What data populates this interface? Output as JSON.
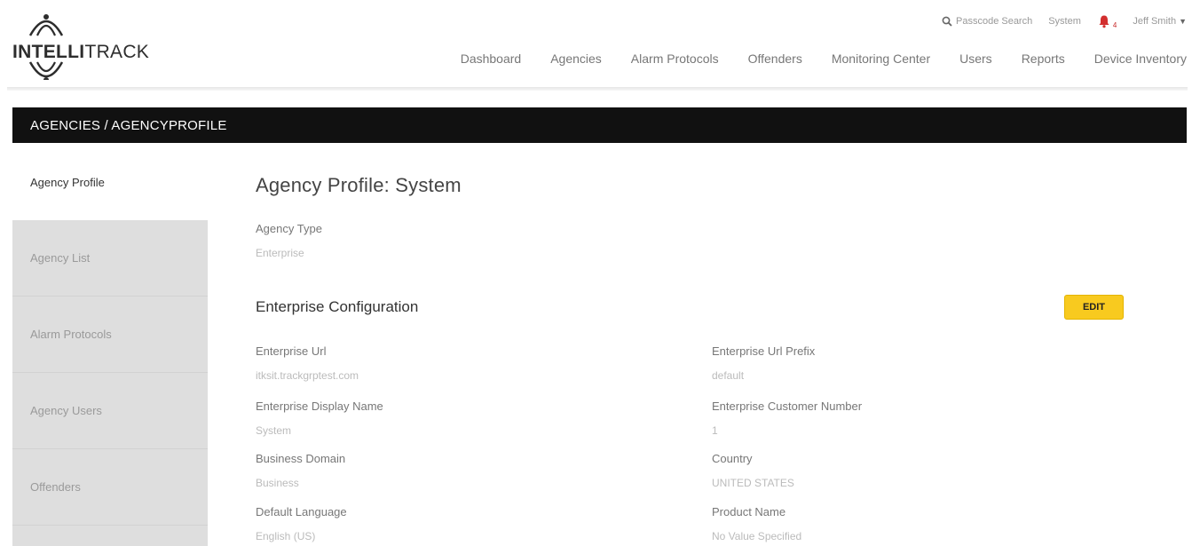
{
  "logo": {
    "bold": "INTELLI",
    "regular": "TRACK"
  },
  "utility": {
    "search_label": "Passcode Search",
    "agency": "System",
    "notification_count": "4",
    "user_name": "Jeff Smith"
  },
  "nav": {
    "items": [
      "Dashboard",
      "Agencies",
      "Alarm Protocols",
      "Offenders",
      "Monitoring Center",
      "Users",
      "Reports",
      "Device Inventory"
    ]
  },
  "breadcrumb": "AGENCIES / AGENCYPROFILE",
  "sidebar": {
    "items": [
      {
        "label": "Agency Profile",
        "active": true
      },
      {
        "label": "Agency List"
      },
      {
        "label": "Alarm Protocols"
      },
      {
        "label": "Agency Users"
      },
      {
        "label": "Offenders"
      }
    ]
  },
  "main": {
    "title": "Agency Profile: System",
    "agency_type_label": "Agency Type",
    "agency_type_value": "Enterprise",
    "section_title": "Enterprise Configuration",
    "edit_label": "EDIT",
    "fields": [
      {
        "label": "Enterprise Url",
        "value": "itksit.trackgrptest.com"
      },
      {
        "label": "Enterprise Url Prefix",
        "value": "default"
      },
      {
        "label": "Enterprise Display Name",
        "value": "System"
      },
      {
        "label": "Enterprise Customer Number",
        "value": "1"
      },
      {
        "label": "Business Domain",
        "value": "Business"
      },
      {
        "label": "Country",
        "value": "UNITED STATES"
      },
      {
        "label": "Default Language",
        "value": "English (US)"
      },
      {
        "label": "Product Name",
        "value": "No Value Specified"
      }
    ]
  },
  "colors": {
    "accent": "#f8ca1f",
    "bell": "#d32f2f",
    "crumb_bg": "#111111"
  }
}
